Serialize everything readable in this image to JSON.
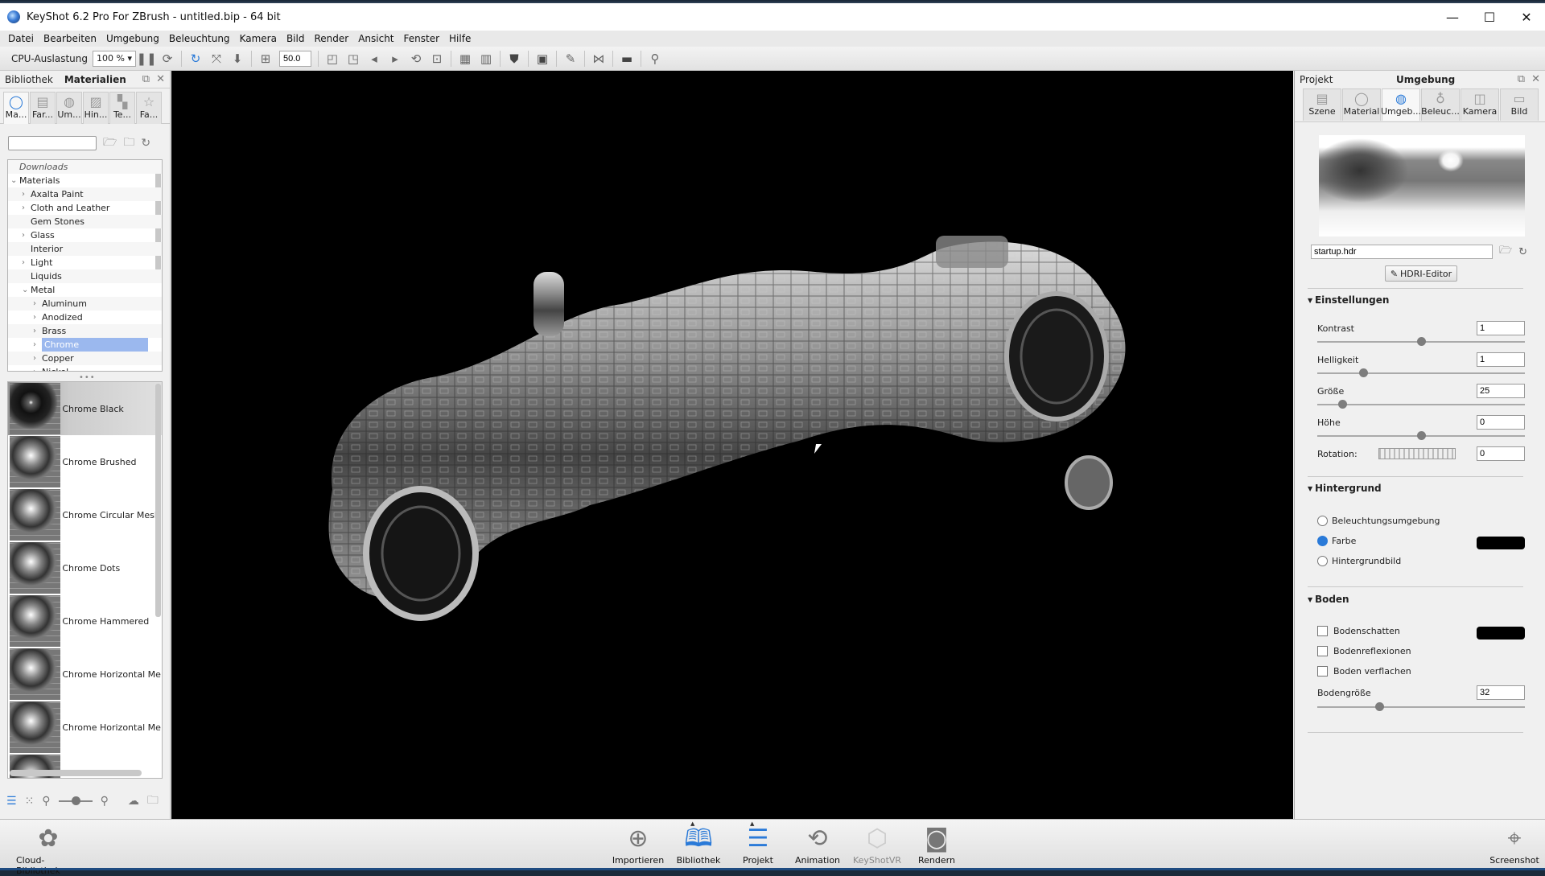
{
  "window": {
    "title": "KeyShot 6.2 Pro For ZBrush - untitled.bip  - 64 bit",
    "controls": {
      "minimize": "—",
      "maximize": "☐",
      "close": "✕"
    }
  },
  "menu": [
    "Datei",
    "Bearbeiten",
    "Umgebung",
    "Beleuchtung",
    "Kamera",
    "Bild",
    "Render",
    "Ansicht",
    "Fenster",
    "Hilfe"
  ],
  "toolbar": {
    "cpu_label": "CPU-Auslastung",
    "cpu_value": "100 %",
    "fov_value": "50.0",
    "icons": [
      "pause-icon",
      "performance-icon",
      "refresh-icon",
      "fit-icon",
      "drop-icon",
      "region-icon",
      "screenshot-add-icon",
      "screenshot-multi-icon",
      "prev-icon",
      "next-icon",
      "sync-icon",
      "lock-icon",
      "studio-add-icon",
      "studio-prev-icon",
      "shield-icon",
      "presentation-icon",
      "paint-icon",
      "geometry-icon",
      "terminal-icon",
      "pose-icon"
    ]
  },
  "library": {
    "tab_inactive": "Bibliothek",
    "tab_active": "Materialien",
    "categories": [
      {
        "label": "Ma...",
        "icon": "material-icon",
        "glyph": "◯",
        "active": true
      },
      {
        "label": "Far...",
        "icon": "color-swatch-icon",
        "glyph": "▤",
        "active": false
      },
      {
        "label": "Um...",
        "icon": "environment-icon",
        "glyph": "◍",
        "active": false
      },
      {
        "label": "Hin...",
        "icon": "backplate-icon",
        "glyph": "▨",
        "active": false
      },
      {
        "label": "Te...",
        "icon": "texture-icon",
        "glyph": "▚",
        "active": false
      },
      {
        "label": "Fa...",
        "icon": "favorites-icon",
        "glyph": "☆",
        "active": false
      }
    ],
    "search_placeholder": "",
    "tree": [
      {
        "label": "Downloads",
        "depth": 0,
        "arrow": "",
        "italic": true
      },
      {
        "label": "Materials",
        "depth": 0,
        "arrow": "⌄"
      },
      {
        "label": "Axalta Paint",
        "depth": 1,
        "arrow": "›"
      },
      {
        "label": "Cloth and Leather",
        "depth": 1,
        "arrow": "›"
      },
      {
        "label": "Gem Stones",
        "depth": 1,
        "arrow": ""
      },
      {
        "label": "Glass",
        "depth": 1,
        "arrow": "›"
      },
      {
        "label": "Interior",
        "depth": 1,
        "arrow": ""
      },
      {
        "label": "Light",
        "depth": 1,
        "arrow": "›"
      },
      {
        "label": "Liquids",
        "depth": 1,
        "arrow": ""
      },
      {
        "label": "Metal",
        "depth": 1,
        "arrow": "⌄"
      },
      {
        "label": "Aluminum",
        "depth": 2,
        "arrow": "›"
      },
      {
        "label": "Anodized",
        "depth": 2,
        "arrow": "›"
      },
      {
        "label": "Brass",
        "depth": 2,
        "arrow": "›"
      },
      {
        "label": "Chrome",
        "depth": 2,
        "arrow": "›",
        "selected": true
      },
      {
        "label": "Copper",
        "depth": 2,
        "arrow": "›"
      },
      {
        "label": "Nickel",
        "depth": 2,
        "arrow": "›"
      }
    ],
    "materials": [
      {
        "name": "Chrome Black",
        "selected": true
      },
      {
        "name": "Chrome Brushed"
      },
      {
        "name": "Chrome Circular Mesh"
      },
      {
        "name": "Chrome Dots"
      },
      {
        "name": "Chrome Hammered"
      },
      {
        "name": "Chrome Horizontal Me"
      },
      {
        "name": "Chrome Horizontal Me"
      },
      {
        "name": ""
      }
    ]
  },
  "project": {
    "tab_inactive": "Projekt",
    "tab_active": "Umgebung",
    "tabs": [
      {
        "label": "Szene",
        "icon": "scene-icon",
        "glyph": "▤"
      },
      {
        "label": "Material",
        "icon": "material-icon",
        "glyph": "◯"
      },
      {
        "label": "Umgeb...",
        "icon": "environment-icon",
        "glyph": "◍",
        "active": true
      },
      {
        "label": "Beleuc...",
        "icon": "lighting-icon",
        "glyph": "♁"
      },
      {
        "label": "Kamera",
        "icon": "camera-icon",
        "glyph": "◫"
      },
      {
        "label": "Bild",
        "icon": "image-icon",
        "glyph": "▭"
      }
    ],
    "hdri_file": "startup.hdr",
    "hdri_editor": "HDRI-Editor",
    "settings": {
      "title": "Einstellungen",
      "contrast": {
        "label": "Kontrast",
        "value": "1",
        "slider": 0.5
      },
      "brightness": {
        "label": "Helligkeit",
        "value": "1",
        "slider": 0.22
      },
      "size": {
        "label": "Größe",
        "value": "25",
        "slider": 0.12
      },
      "height": {
        "label": "Höhe",
        "value": "0",
        "slider": 0.5
      },
      "rotation": {
        "label": "Rotation:",
        "value": "0"
      }
    },
    "background": {
      "title": "Hintergrund",
      "options": [
        {
          "label": "Beleuchtungsumgebung",
          "checked": false
        },
        {
          "label": "Farbe",
          "checked": true
        },
        {
          "label": "Hintergrundbild",
          "checked": false
        }
      ],
      "color": "#000000"
    },
    "ground": {
      "title": "Boden",
      "shadow": {
        "label": "Bodenschatten",
        "checked": false
      },
      "reflections": {
        "label": "Bodenreflexionen",
        "checked": false
      },
      "flatten": {
        "label": "Boden verflachen",
        "checked": false
      },
      "size": {
        "label": "Bodengröße",
        "value": "32",
        "slider": 0.3
      },
      "shadow_color": "#000000"
    }
  },
  "bottombar": {
    "cloud": "Cloud-Bibliothek",
    "items": [
      {
        "label": "Importieren",
        "icon": "import-icon",
        "glyph": "⊕"
      },
      {
        "label": "Bibliothek",
        "icon": "library-book-icon",
        "glyph": "🕮",
        "active": true
      },
      {
        "label": "Projekt",
        "icon": "project-list-icon",
        "glyph": "☰",
        "active": true
      },
      {
        "label": "Animation",
        "icon": "animation-play-icon",
        "glyph": "⟲"
      },
      {
        "label": "KeyShotVR",
        "icon": "keyshotvr-icon",
        "glyph": "⬡",
        "disabled": true
      },
      {
        "label": "Rendern",
        "icon": "render-icon",
        "glyph": "◙"
      }
    ],
    "screenshot": "Screenshot"
  }
}
